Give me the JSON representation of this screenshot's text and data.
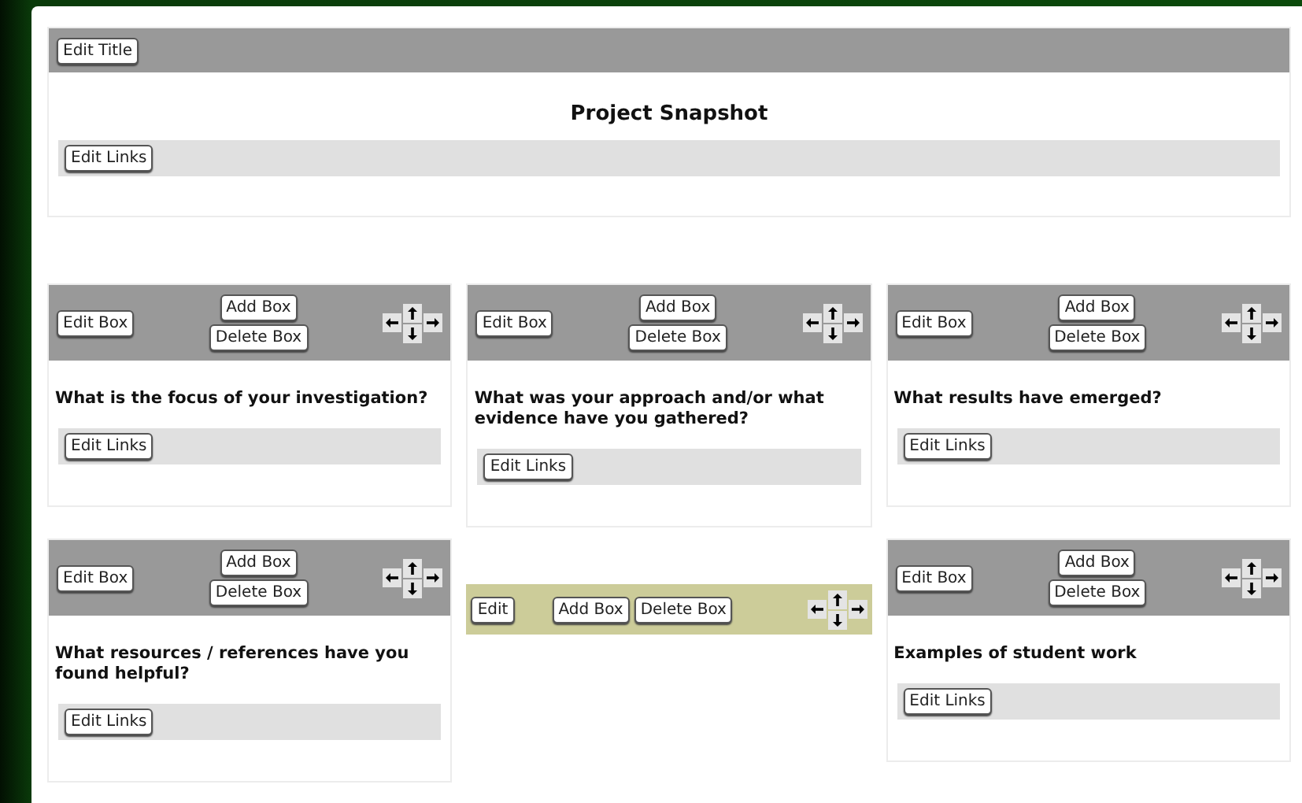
{
  "title_card": {
    "edit_button": "Edit Title",
    "title": "Project Snapshot",
    "links_button": "Edit Links"
  },
  "columns": [
    [
      {
        "kind": "box",
        "edit_button": "Edit Box",
        "add_button": "Add Box",
        "delete_button": "Delete Box",
        "question": "What is the focus of your investigation?",
        "links_button": "Edit Links"
      },
      {
        "kind": "box",
        "edit_button": "Edit Box",
        "add_button": "Add Box",
        "delete_button": "Delete Box",
        "question": "What resources / references have you found helpful?",
        "links_button": "Edit Links"
      }
    ],
    [
      {
        "kind": "box",
        "edit_button": "Edit Box",
        "add_button": "Add Box",
        "delete_button": "Delete Box",
        "question": "What was your approach and/or what evidence have you gathered?",
        "links_button": "Edit Links"
      },
      {
        "kind": "placeholder",
        "edit_button": "Edit",
        "add_button": "Add Box",
        "delete_button": "Delete Box"
      }
    ],
    [
      {
        "kind": "box",
        "edit_button": "Edit Box",
        "add_button": "Add Box",
        "delete_button": "Delete Box",
        "question": "What results have emerged?",
        "links_button": "Edit Links"
      },
      {
        "kind": "box",
        "edit_button": "Edit Box",
        "add_button": "Add Box",
        "delete_button": "Delete Box",
        "question": "Examples of student work",
        "links_button": "Edit Links"
      }
    ]
  ]
}
